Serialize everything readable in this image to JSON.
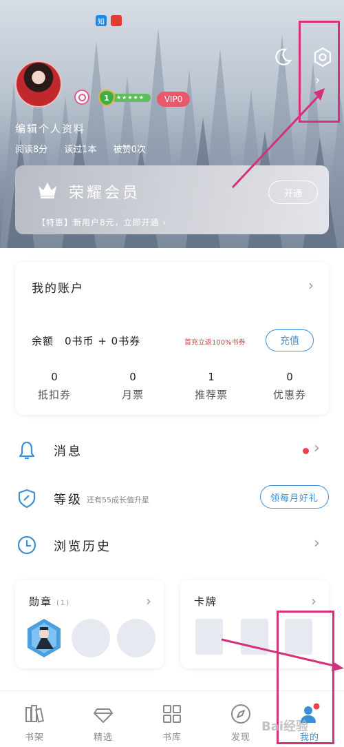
{
  "top_badges": {
    "zhi": "知",
    "red": ""
  },
  "header": {
    "edit_profile": "编辑个人资料",
    "stats": [
      {
        "label": "阅读8分"
      },
      {
        "label": "读过1本"
      },
      {
        "label": "被赞0次"
      }
    ],
    "level": "1",
    "level_stars": "★★★★★",
    "vip_label": "VIP0",
    "chevron": "›"
  },
  "member_card": {
    "title": "荣耀会员",
    "button": "开通",
    "promo": "【特惠】新用户8元，立即开通 ›"
  },
  "account": {
    "title": "我的账户",
    "chevron": "›",
    "balance": "余额　0书币 + 0书券",
    "recharge_note": "首充立返100%书券",
    "recharge_button": "充值",
    "stats": [
      {
        "num": "0",
        "label": "抵扣券"
      },
      {
        "num": "0",
        "label": "月票"
      },
      {
        "num": "1",
        "label": "推荐票"
      },
      {
        "num": "0",
        "label": "优惠券"
      }
    ]
  },
  "list": {
    "messages": {
      "label": "消息",
      "chevron": "›"
    },
    "level": {
      "label": "等级",
      "sub": "还有55成长值升星",
      "button": "领每月好礼"
    },
    "history": {
      "label": "浏览历史",
      "chevron": "›"
    }
  },
  "badges_panel": {
    "title": "勋章",
    "count": "(1)",
    "chevron": "›"
  },
  "cards_panel": {
    "title": "卡牌",
    "chevron": "›"
  },
  "bottom_nav": {
    "items": [
      {
        "label": "书架",
        "icon": "bookshelf-icon"
      },
      {
        "label": "精选",
        "icon": "diamond-icon"
      },
      {
        "label": "书库",
        "icon": "grid-icon"
      },
      {
        "label": "发现",
        "icon": "compass-icon"
      },
      {
        "label": "我的",
        "icon": "profile-icon"
      }
    ]
  },
  "watermark": "Bai经验",
  "colors": {
    "accent": "#3a8fd8",
    "annotation": "#d4317a",
    "vip": "#e8596b",
    "red_dot": "#e8434e"
  }
}
